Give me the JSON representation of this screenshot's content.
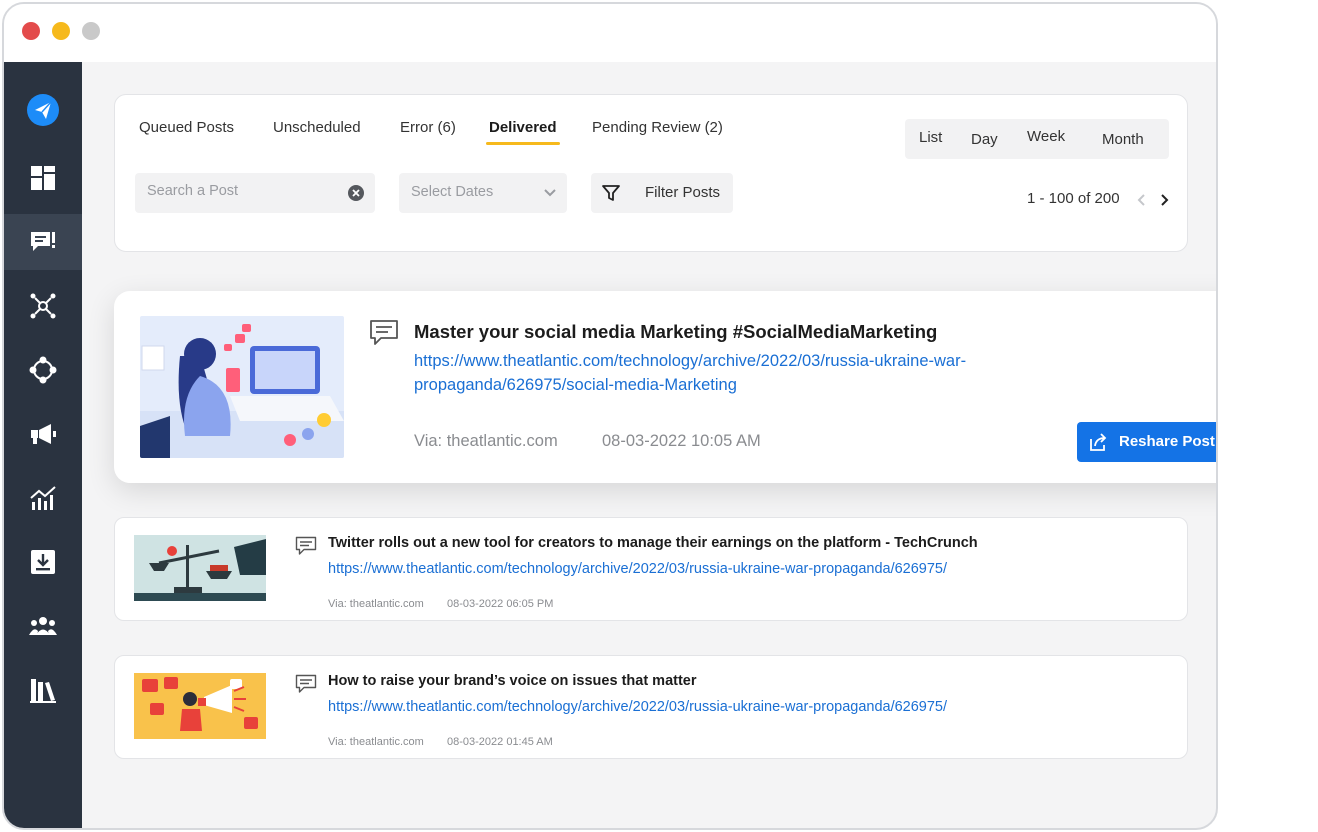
{
  "tabs": [
    {
      "label": "Queued Posts"
    },
    {
      "label": "Unscheduled"
    },
    {
      "label": "Error (6)"
    },
    {
      "label": "Delivered"
    },
    {
      "label": "Pending Review (2)"
    }
  ],
  "active_tab": "Delivered",
  "views": [
    "List",
    "Day",
    "Week",
    "Month"
  ],
  "search": {
    "placeholder": "Search a Post",
    "value": ""
  },
  "date_select": {
    "placeholder": "Select Dates"
  },
  "filter": {
    "label": "Filter Posts"
  },
  "pagination": {
    "range": "1 - 100 of 200"
  },
  "posts": [
    {
      "title": "Master your social media Marketing #SocialMediaMarketing",
      "link": "https://www.theatlantic.com/technology/archive/2022/03/russia-ukraine-war-propaganda/626975/social-media-Marketing",
      "via": "Via: theatlantic.com",
      "date": "08-03-2022 10:05 AM",
      "action": "Reshare Post"
    },
    {
      "title": "Twitter rolls out a new tool for creators to manage their earnings on the platform - TechCrunch",
      "link": "https://www.theatlantic.com/technology/archive/2022/03/russia-ukraine-war-propaganda/626975/",
      "via": "Via: theatlantic.com",
      "date": "08-03-2022 06:05 PM"
    },
    {
      "title": "How to raise your brand’s voice on issues that matter",
      "link": "https://www.theatlantic.com/technology/archive/2022/03/russia-ukraine-war-propaganda/626975/",
      "via": "Via: theatlantic.com",
      "date": "08-03-2022 01:45 AM"
    }
  ],
  "sidebar_icons": [
    "paper-plane-logo-icon",
    "dashboard-icon",
    "publish-icon",
    "network-icon",
    "hub-icon",
    "megaphone-icon",
    "analytics-icon",
    "download-icon",
    "team-icon",
    "library-icon"
  ],
  "colors": {
    "accent": "#1473e6",
    "link": "#1a6fd4",
    "tab_underline": "#f6b91c",
    "sidebar": "#2a3340"
  }
}
